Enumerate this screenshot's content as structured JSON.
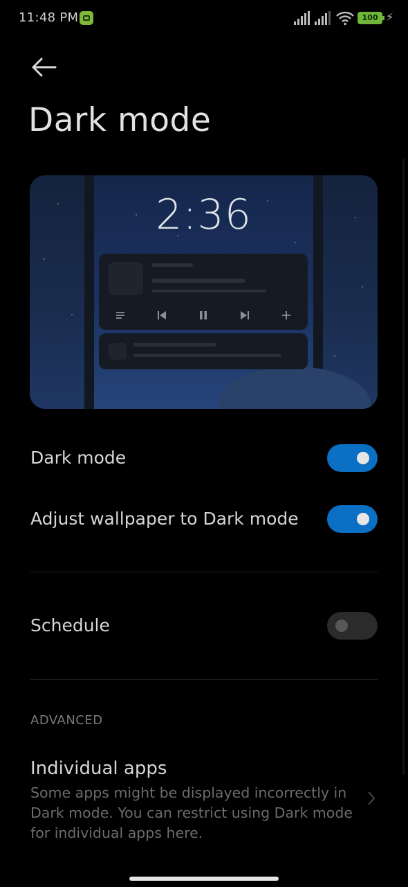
{
  "status_bar": {
    "time": "11:48 PM",
    "battery": "100"
  },
  "header": {
    "title": "Dark mode"
  },
  "preview": {
    "clock": "2:36"
  },
  "settings": {
    "dark_mode": {
      "label": "Dark mode",
      "enabled": true
    },
    "adjust_wallpaper": {
      "label": "Adjust wallpaper to Dark mode",
      "enabled": true
    },
    "schedule": {
      "label": "Schedule",
      "enabled": false
    }
  },
  "advanced": {
    "section_label": "ADVANCED",
    "individual_apps": {
      "title": "Individual apps",
      "description": "Some apps might be displayed incorrectly in Dark mode. You can restrict using Dark mode for individual apps here."
    }
  },
  "colors": {
    "accent": "#0b6fc4",
    "background": "#000000"
  }
}
